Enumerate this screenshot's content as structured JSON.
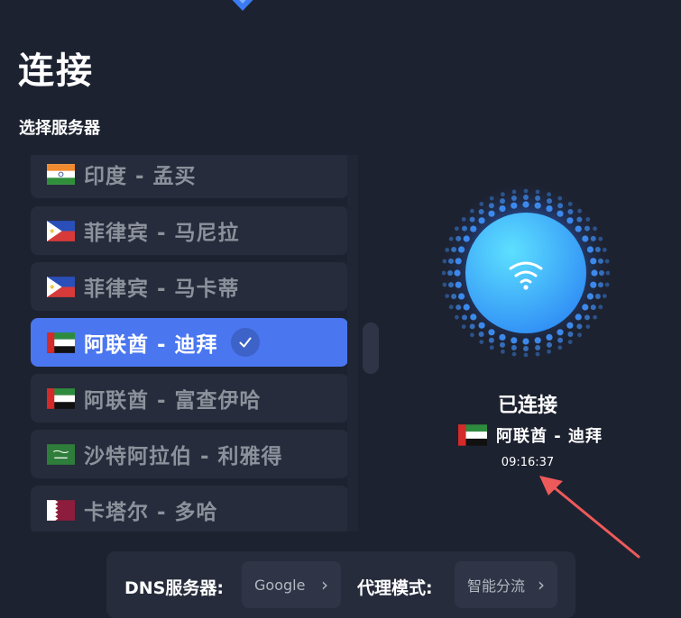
{
  "page": {
    "title": "连接",
    "subtitle": "选择服务器"
  },
  "servers": [
    {
      "flag": "india",
      "label": "印度 - 孟买",
      "selected": false
    },
    {
      "flag": "philippines",
      "label": "菲律宾 - 马尼拉",
      "selected": false
    },
    {
      "flag": "philippines",
      "label": "菲律宾 - 马卡蒂",
      "selected": false
    },
    {
      "flag": "uae",
      "label": "阿联酋 - 迪拜",
      "selected": true
    },
    {
      "flag": "uae",
      "label": "阿联酋 - 富查伊哈",
      "selected": false
    },
    {
      "flag": "saudi-arabia",
      "label": "沙特阿拉伯 - 利雅得",
      "selected": false
    },
    {
      "flag": "qatar",
      "label": "卡塔尔 - 多哈",
      "selected": false
    }
  ],
  "connection": {
    "status": "已连接",
    "server_flag": "uae",
    "server_label": "阿联酋 - 迪拜",
    "time": "09:16:37",
    "icon": "wifi-icon"
  },
  "settings": {
    "dns_label": "DNS服务器:",
    "dns_value": "Google",
    "proxy_label": "代理模式:",
    "proxy_value": "智能分流"
  },
  "colors": {
    "background": "#1d2230",
    "item_bg": "#262c3b",
    "accent": "#4a76f0",
    "arrow": "#ee5a5a"
  }
}
